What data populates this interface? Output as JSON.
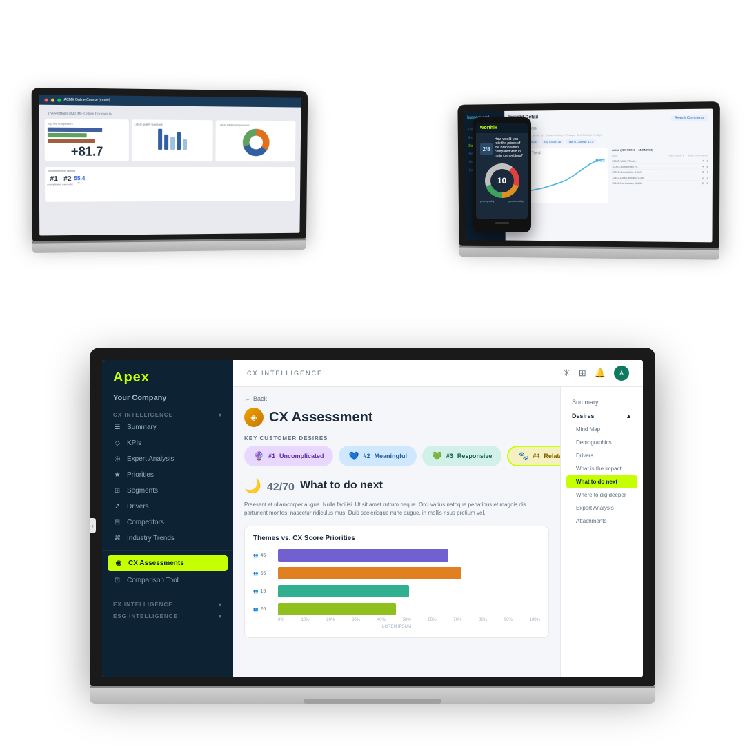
{
  "scene": {
    "bg_color": "#ffffff"
  },
  "laptop_main": {
    "sidebar": {
      "logo": "Apex",
      "company": "Your Company",
      "cx_section": "CX INTELLIGENCE",
      "items": [
        {
          "label": "Summary",
          "icon": "☰",
          "active": false
        },
        {
          "label": "KPIs",
          "icon": "◇",
          "active": false
        },
        {
          "label": "Expert Analysis",
          "icon": "◎",
          "active": false
        },
        {
          "label": "Priorities",
          "icon": "★",
          "active": false
        },
        {
          "label": "Segments",
          "icon": "⊞",
          "active": false
        },
        {
          "label": "Drivers",
          "icon": "↗",
          "active": false
        },
        {
          "label": "Competitors",
          "icon": "⊟",
          "active": false
        },
        {
          "label": "Industry Trends",
          "icon": "⌘",
          "active": false
        },
        {
          "label": "CX Assessments",
          "icon": "◉",
          "active": true
        },
        {
          "label": "Comparison Tool",
          "icon": "⊡",
          "active": false
        }
      ],
      "ex_section": "EX INTELLIGENCE",
      "esg_section": "ESG INTELLIGENCE"
    },
    "topbar": {
      "label": "CX INTELLIGENCE",
      "icons": [
        "✳",
        "⊞",
        "🔔"
      ],
      "avatar": "A"
    },
    "content": {
      "back_label": "Back",
      "page_title": "CX Assessment",
      "key_desires_label": "KEY CUSTOMER DESIRES",
      "desires": [
        {
          "num": "#1",
          "label": "Uncomplicated",
          "style": "purple"
        },
        {
          "num": "#2",
          "label": "Meaningful",
          "style": "blue"
        },
        {
          "num": "#3",
          "label": "Responsive",
          "style": "teal"
        },
        {
          "num": "#4",
          "label": "Relatable",
          "style": "yellow"
        }
      ],
      "score": "42",
      "score_max": "70",
      "section_title": "What to do next",
      "body_text": "Praesent et ullamcorper augue. Nulla facilisi. Ut sit amet rutrum neque. Orci varius natoque penatibus et magnis dis parturient montes, nascetur ridiculus mus. Duis scelerisque nunc augue, in mollis risus pretium vel.",
      "chart_title": "Themes vs. CX Score Priorities",
      "chart_bars": [
        {
          "label": "45",
          "color": "purple",
          "width": "65%"
        },
        {
          "label": "55",
          "color": "orange",
          "width": "70%"
        },
        {
          "label": "15",
          "color": "teal",
          "width": "50%"
        },
        {
          "label": "26",
          "color": "green",
          "width": "45%"
        }
      ],
      "chart_axis": [
        "0%",
        "10%",
        "20%",
        "30%",
        "40%",
        "50%",
        "60%",
        "70%",
        "80%",
        "90%",
        "100%"
      ],
      "chart_footer": "LOREM IPSUM"
    },
    "sub_nav": {
      "items": [
        {
          "label": "Summary",
          "active": false
        },
        {
          "label": "Desires",
          "active": false,
          "has_arrow": true
        },
        {
          "label": "Mind Map",
          "active": false,
          "indent": true
        },
        {
          "label": "Demographics",
          "active": false,
          "indent": true
        },
        {
          "label": "Drivers",
          "active": false,
          "indent": true
        },
        {
          "label": "What is the impact",
          "active": false,
          "indent": true
        },
        {
          "label": "What to do next",
          "active": true,
          "indent": true
        },
        {
          "label": "Where to dig deeper",
          "active": false,
          "indent": true
        },
        {
          "label": "Expert Analysis",
          "active": false,
          "indent": true
        },
        {
          "label": "Attachments",
          "active": false,
          "indent": true
        }
      ]
    }
  },
  "phone": {
    "logo": "worthix",
    "rating_text": "How would you rate the prices of the Brand when compared with its main competitors?",
    "dial_value": "10",
    "label_left": "poor quality",
    "label_right": "good quality"
  },
  "laptop_bg": {
    "title": "ACME Online Course [model]",
    "chart_label": "The Portfolio of ACME Online Courses is:"
  },
  "laptop_tr": {
    "logo": "inmoment",
    "title": "Insight Detail",
    "subtitle": "Pos. Attentiveness",
    "tags": [
      "Apex Shower Trends",
      "Tag Count: 26",
      "Tag % Change: 12.5"
    ],
    "chart_label": "Anomaly Tag Trend",
    "table_label": "Areas (08/04/2016 - 11/05/2021)"
  }
}
